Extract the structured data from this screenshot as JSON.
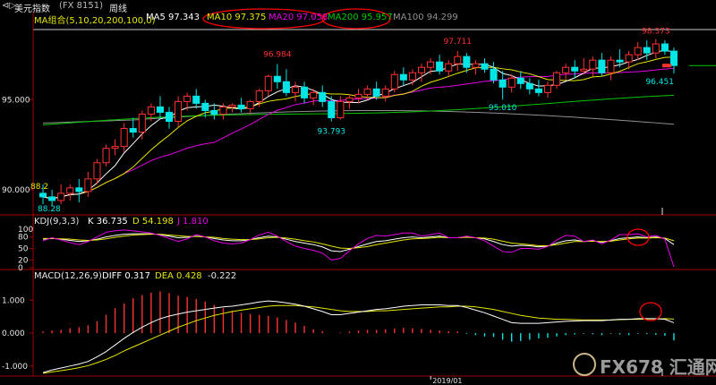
{
  "window": {
    "icon": "triangle-icon",
    "symbol_name": "美元指数",
    "symbol_code": "(FX 8151)",
    "period": "周线"
  },
  "legends": {
    "ma": {
      "name": "MA组合(5,10,20,200,100,0)",
      "ma5": "MA5 97.343",
      "ma10": "MA10 97.375",
      "ma20": "MA20 97.058",
      "ma200": "MA200 95.957",
      "ma100": "MA100 94.299"
    },
    "kdj": {
      "name": "KDJ(9,3,3)",
      "k": "K 36.735",
      "d": "D 54.198",
      "j": "J 1.810"
    },
    "macd": {
      "name": "MACD(12,26,9)",
      "diff": "DIFF 0.317",
      "dea": "DEA 0.428",
      "macd": "-0.222"
    }
  },
  "date_label": "2019/01",
  "watermark": "FX678 汇通网",
  "colors": {
    "up": "#ff3232",
    "down": "#00e5e5",
    "ma5": "#ffffff",
    "ma10": "#e6e600",
    "ma20": "#e600e6",
    "ma200": "#00c800",
    "ma100": "#909090",
    "k": "#ffffff",
    "d": "#e6e600",
    "j": "#e600e6",
    "axis": "#a00000",
    "highlight": "#ff0000"
  },
  "chart_data": [
    {
      "type": "candlestick",
      "ylim": [
        88.7,
        98.9
      ],
      "yticks": [
        "95.000",
        "90.000"
      ],
      "annotations": [
        "96.984",
        "97.711",
        "98.373",
        "93.793",
        "95.010",
        "96.451",
        "88.2",
        "88.28"
      ],
      "ohlc": [
        [
          89.8,
          90.3,
          89.2,
          89.6
        ],
        [
          89.6,
          90.0,
          89.1,
          89.4
        ],
        [
          89.4,
          90.3,
          89.2,
          89.8
        ],
        [
          89.8,
          90.3,
          89.4,
          90.1
        ],
        [
          90.1,
          90.6,
          89.3,
          89.9
        ],
        [
          89.9,
          91.0,
          89.6,
          90.6
        ],
        [
          90.6,
          91.7,
          90.3,
          91.5
        ],
        [
          91.5,
          92.5,
          91.3,
          92.3
        ],
        [
          92.3,
          92.8,
          91.9,
          92.4
        ],
        [
          92.4,
          93.7,
          92.1,
          93.4
        ],
        [
          93.4,
          94.0,
          92.9,
          93.2
        ],
        [
          93.2,
          94.4,
          92.8,
          94.2
        ],
        [
          94.2,
          94.8,
          93.8,
          94.6
        ],
        [
          94.6,
          95.2,
          93.9,
          94.3
        ],
        [
          94.3,
          94.6,
          93.4,
          93.8
        ],
        [
          93.8,
          95.2,
          93.5,
          94.9
        ],
        [
          94.9,
          95.4,
          94.4,
          95.2
        ],
        [
          95.2,
          95.6,
          94.5,
          94.8
        ],
        [
          94.8,
          95.0,
          94.0,
          94.4
        ],
        [
          94.4,
          94.8,
          93.9,
          94.2
        ],
        [
          94.2,
          94.8,
          93.9,
          94.6
        ],
        [
          94.6,
          94.8,
          94.3,
          94.7
        ],
        [
          94.7,
          95.1,
          94.3,
          94.5
        ],
        [
          94.5,
          95.0,
          94.2,
          94.9
        ],
        [
          94.9,
          95.6,
          94.6,
          95.5
        ],
        [
          95.5,
          96.4,
          95.2,
          96.3
        ],
        [
          96.3,
          96.984,
          95.6,
          96.0
        ],
        [
          96.0,
          96.7,
          95.2,
          95.4
        ],
        [
          95.4,
          96.0,
          94.9,
          95.7
        ],
        [
          95.7,
          96.0,
          94.8,
          95.1
        ],
        [
          95.1,
          95.6,
          94.7,
          95.4
        ],
        [
          95.4,
          95.8,
          94.6,
          94.9
        ],
        [
          94.9,
          95.2,
          93.793,
          94.0
        ],
        [
          94.0,
          95.2,
          93.9,
          94.9
        ],
        [
          94.9,
          95.3,
          94.5,
          95.1
        ],
        [
          95.1,
          95.6,
          94.8,
          95.3
        ],
        [
          95.3,
          95.8,
          95.0,
          95.6
        ],
        [
          95.6,
          96.0,
          95.0,
          95.2
        ],
        [
          95.2,
          95.8,
          94.9,
          95.6
        ],
        [
          95.6,
          96.6,
          95.4,
          96.4
        ],
        [
          96.4,
          96.8,
          95.8,
          96.1
        ],
        [
          96.1,
          96.7,
          95.8,
          96.5
        ],
        [
          96.5,
          97.0,
          96.0,
          96.8
        ],
        [
          96.8,
          97.3,
          96.4,
          97.1
        ],
        [
          97.1,
          97.5,
          96.4,
          96.6
        ],
        [
          96.6,
          97.2,
          96.3,
          97.0
        ],
        [
          97.0,
          97.711,
          96.6,
          97.4
        ],
        [
          97.4,
          97.6,
          96.5,
          96.8
        ],
        [
          96.8,
          97.2,
          96.4,
          97.0
        ],
        [
          97.0,
          97.3,
          96.5,
          96.7
        ],
        [
          96.7,
          97.1,
          95.9,
          96.1
        ],
        [
          96.1,
          96.6,
          95.01,
          95.7
        ],
        [
          95.7,
          96.4,
          95.4,
          96.2
        ],
        [
          96.2,
          96.6,
          95.6,
          95.9
        ],
        [
          95.9,
          96.2,
          95.3,
          95.6
        ],
        [
          95.6,
          96.1,
          95.2,
          95.4
        ],
        [
          95.4,
          96.0,
          95.1,
          95.8
        ],
        [
          95.8,
          96.6,
          95.6,
          96.5
        ],
        [
          96.5,
          97.0,
          96.1,
          96.8
        ],
        [
          96.8,
          97.2,
          96.2,
          96.6
        ],
        [
          96.6,
          97.3,
          96.4,
          96.7
        ],
        [
          96.7,
          97.4,
          96.3,
          97.2
        ],
        [
          97.2,
          97.6,
          96.3,
          96.5
        ],
        [
          96.5,
          97.4,
          96.1,
          97.2
        ],
        [
          97.2,
          97.8,
          96.8,
          97.1
        ],
        [
          97.1,
          97.7,
          96.7,
          97.5
        ],
        [
          97.5,
          98.2,
          97.2,
          97.9
        ],
        [
          97.9,
          98.3,
          97.2,
          97.6
        ],
        [
          97.6,
          98.373,
          97.3,
          98.1
        ],
        [
          98.1,
          98.3,
          97.5,
          97.7
        ],
        [
          97.7,
          97.9,
          96.451,
          96.9
        ]
      ]
    },
    {
      "type": "line",
      "title": "KDJ(9,3,3)",
      "ylim": [
        0,
        100
      ],
      "yticks": [
        "100",
        "80",
        "50",
        "20",
        "0"
      ],
      "series": [
        {
          "name": "K",
          "values": [
            74,
            76,
            74,
            71,
            68,
            70,
            74,
            80,
            84,
            87,
            88,
            88,
            88,
            86,
            82,
            78,
            79,
            82,
            80,
            76,
            72,
            70,
            70,
            73,
            78,
            82,
            80,
            74,
            68,
            64,
            60,
            54,
            44,
            42,
            48,
            55,
            62,
            68,
            70,
            74,
            78,
            80,
            78,
            80,
            82,
            78,
            78,
            80,
            78,
            75,
            68,
            60,
            56,
            58,
            57,
            54,
            56,
            64,
            70,
            72,
            68,
            70,
            66,
            70,
            76,
            78,
            80,
            78,
            80,
            76,
            60
          ]
        },
        {
          "name": "D",
          "values": [
            76,
            76,
            75,
            74,
            72,
            71,
            72,
            75,
            79,
            82,
            85,
            86,
            87,
            87,
            85,
            83,
            81,
            81,
            80,
            79,
            76,
            74,
            73,
            73,
            75,
            78,
            79,
            77,
            74,
            70,
            67,
            62,
            56,
            51,
            50,
            52,
            55,
            60,
            64,
            68,
            72,
            75,
            76,
            77,
            79,
            78,
            78,
            79,
            78,
            77,
            74,
            69,
            64,
            62,
            60,
            57,
            57,
            60,
            64,
            68,
            68,
            69,
            68,
            69,
            72,
            75,
            77,
            77,
            78,
            77,
            70
          ]
        },
        {
          "name": "J",
          "values": [
            70,
            78,
            72,
            65,
            60,
            68,
            80,
            92,
            96,
            98,
            96,
            93,
            90,
            84,
            76,
            68,
            75,
            86,
            80,
            70,
            64,
            62,
            64,
            73,
            85,
            92,
            82,
            68,
            56,
            50,
            45,
            38,
            20,
            24,
            44,
            62,
            76,
            84,
            82,
            86,
            90,
            90,
            82,
            86,
            90,
            78,
            78,
            82,
            78,
            70,
            56,
            42,
            40,
            50,
            50,
            48,
            55,
            72,
            84,
            82,
            68,
            72,
            62,
            72,
            86,
            86,
            88,
            80,
            84,
            74,
            2
          ]
        }
      ]
    },
    {
      "type": "bar",
      "title": "MACD(12,26,9)",
      "ylim": [
        -1.25,
        1.5
      ],
      "yticks": [
        "1.000",
        "0.000",
        "-1.000"
      ],
      "histogram": [
        0.05,
        0.08,
        0.1,
        0.15,
        0.18,
        0.24,
        0.36,
        0.56,
        0.76,
        0.9,
        1.06,
        1.16,
        1.23,
        1.27,
        1.22,
        1.14,
        1.1,
        1.04,
        0.96,
        0.86,
        0.76,
        0.68,
        0.62,
        0.58,
        0.56,
        0.52,
        0.48,
        0.4,
        0.32,
        0.22,
        0.12,
        0.06,
        0.0,
        0.02,
        0.05,
        0.08,
        0.1,
        0.1,
        0.12,
        0.14,
        0.16,
        0.15,
        0.13,
        0.1,
        0.08,
        0.06,
        0.05,
        -0.02,
        -0.06,
        -0.1,
        -0.12,
        -0.2,
        -0.26,
        -0.24,
        -0.2,
        -0.16,
        -0.14,
        -0.1,
        -0.06,
        -0.04,
        -0.02,
        -0.03,
        -0.06,
        -0.02,
        -0.04,
        -0.06,
        -0.02,
        -0.03,
        -0.05,
        -0.08,
        -0.222
      ],
      "series": [
        {
          "name": "DIFF",
          "values": [
            -1.2,
            -1.12,
            -1.06,
            -1.0,
            -0.94,
            -0.86,
            -0.72,
            -0.56,
            -0.36,
            -0.16,
            0.02,
            0.18,
            0.32,
            0.44,
            0.52,
            0.58,
            0.64,
            0.68,
            0.72,
            0.76,
            0.8,
            0.82,
            0.86,
            0.9,
            0.95,
            0.98,
            0.96,
            0.92,
            0.88,
            0.82,
            0.74,
            0.66,
            0.56,
            0.56,
            0.6,
            0.64,
            0.68,
            0.72,
            0.74,
            0.78,
            0.82,
            0.84,
            0.86,
            0.86,
            0.86,
            0.84,
            0.84,
            0.78,
            0.7,
            0.62,
            0.52,
            0.42,
            0.32,
            0.3,
            0.3,
            0.3,
            0.32,
            0.34,
            0.36,
            0.37,
            0.38,
            0.38,
            0.38,
            0.4,
            0.42,
            0.42,
            0.44,
            0.44,
            0.44,
            0.42,
            0.317
          ]
        },
        {
          "name": "DEA",
          "values": [
            -1.22,
            -1.18,
            -1.14,
            -1.1,
            -1.05,
            -0.99,
            -0.9,
            -0.8,
            -0.68,
            -0.54,
            -0.42,
            -0.3,
            -0.18,
            -0.06,
            0.06,
            0.18,
            0.28,
            0.38,
            0.46,
            0.54,
            0.6,
            0.66,
            0.7,
            0.74,
            0.78,
            0.82,
            0.84,
            0.84,
            0.84,
            0.82,
            0.8,
            0.76,
            0.72,
            0.68,
            0.66,
            0.66,
            0.66,
            0.68,
            0.68,
            0.7,
            0.72,
            0.74,
            0.76,
            0.78,
            0.8,
            0.8,
            0.82,
            0.82,
            0.8,
            0.76,
            0.72,
            0.66,
            0.6,
            0.54,
            0.5,
            0.46,
            0.44,
            0.42,
            0.42,
            0.41,
            0.4,
            0.4,
            0.4,
            0.4,
            0.41,
            0.42,
            0.42,
            0.43,
            0.43,
            0.44,
            0.428
          ]
        }
      ]
    }
  ]
}
